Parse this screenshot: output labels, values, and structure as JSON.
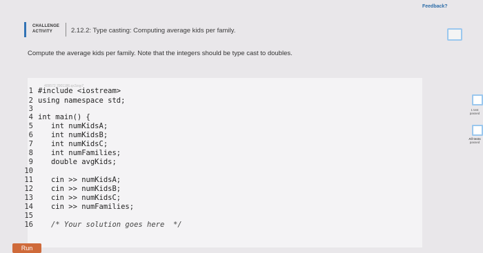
{
  "feedback_label": "Feedback?",
  "activity": {
    "badge_line1": "CHALLENGE",
    "badge_line2": "ACTIVITY",
    "title": "2.12.2: Type casting: Computing average kids per family."
  },
  "instruction": "Compute the average kids per family. Note that the integers should be type cast to doubles.",
  "watermark": "409572.2901186.qx3zqy7",
  "code_lines": [
    {
      "num": "1",
      "text": "#include <iostream>"
    },
    {
      "num": "2",
      "text": "using namespace std;"
    },
    {
      "num": "3",
      "text": ""
    },
    {
      "num": "4",
      "text": "int main() {"
    },
    {
      "num": "5",
      "text": "   int numKidsA;"
    },
    {
      "num": "6",
      "text": "   int numKidsB;"
    },
    {
      "num": "7",
      "text": "   int numKidsC;"
    },
    {
      "num": "8",
      "text": "   int numFamilies;"
    },
    {
      "num": "9",
      "text": "   double avgKids;"
    },
    {
      "num": "10",
      "text": ""
    },
    {
      "num": "11",
      "text": "   cin >> numKidsA;"
    },
    {
      "num": "12",
      "text": "   cin >> numKidsB;"
    },
    {
      "num": "13",
      "text": "   cin >> numKidsC;"
    },
    {
      "num": "14",
      "text": "   cin >> numFamilies;"
    },
    {
      "num": "15",
      "text": ""
    },
    {
      "num": "16",
      "text": "   /* Your solution goes here  */"
    }
  ],
  "run_label": "Run",
  "tests": {
    "one_test_line1": "1 test",
    "one_test_line2": "passed",
    "all_tests_line1": "All tests",
    "all_tests_line2": "passed"
  }
}
